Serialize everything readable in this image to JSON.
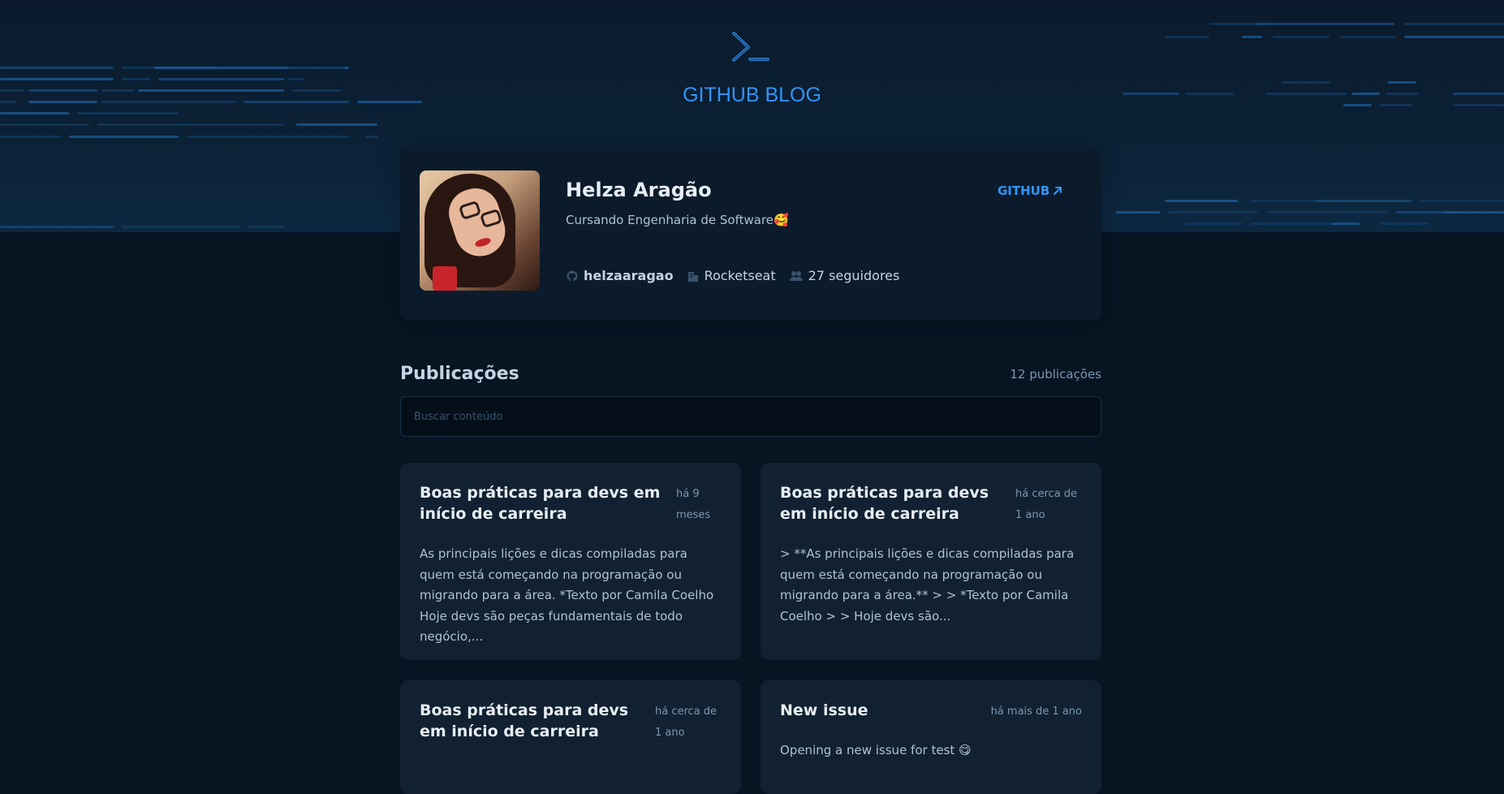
{
  "brand": {
    "title": "GITHUB BLOG",
    "logo_icon": "terminal-prompt-icon"
  },
  "profile": {
    "name": "Helza Aragão",
    "github_label": "GITHUB",
    "github_icon": "arrow-up-right-icon",
    "bio": "Cursando Engenharia de Software🥰",
    "username": "helzaaragao",
    "company": "Rocketseat",
    "followers": "27 seguidores"
  },
  "publications": {
    "title": "Publicações",
    "count": "12 publicações",
    "search_placeholder": "Buscar conteúdo"
  },
  "posts": [
    {
      "title": "Boas práticas para devs em início de carreira",
      "time": "há 9 meses",
      "body": "As principais lições e dicas compiladas para quem está começando na programação ou migrando para a área. *Texto por Camila Coelho Hoje devs são peças fundamentais de todo negócio,..."
    },
    {
      "title": "Boas práticas para devs em início de carreira",
      "time": "há cerca de 1 ano",
      "body": "> **As principais lições e dicas compiladas para quem está começando na programação ou migrando para a área.** > > *Texto por Camila Coelho > > Hoje devs são..."
    },
    {
      "title": "Boas práticas para devs em início de carreira",
      "time": "há cerca de 1 ano",
      "body": ""
    },
    {
      "title": "New issue",
      "time": "há mais de 1 ano",
      "body": "Opening a new issue for test 😋"
    }
  ],
  "colors": {
    "brand_blue": "#3294F8",
    "background": "#071422",
    "card": "#112131",
    "profile_card": "#0B1B2B"
  }
}
